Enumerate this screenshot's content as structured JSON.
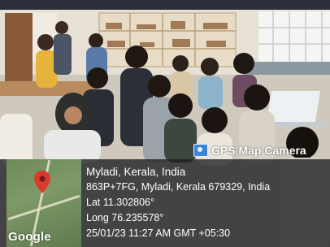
{
  "stamp": {
    "app_name": "GPS Map Camera",
    "place": "Myladi, Kerala, India",
    "address": "863P+7FG, Myladi, Kerala 679329, India",
    "lat": "Lat 11.302806°",
    "long": "Long 76.235578°",
    "datetime": "25/01/23 11:27 AM GMT +05:30",
    "map_brand": "Google"
  },
  "colors": {
    "overlay": "#1c1e22",
    "pin": "#d93a2e",
    "camera_icon": "#3c86d8"
  }
}
